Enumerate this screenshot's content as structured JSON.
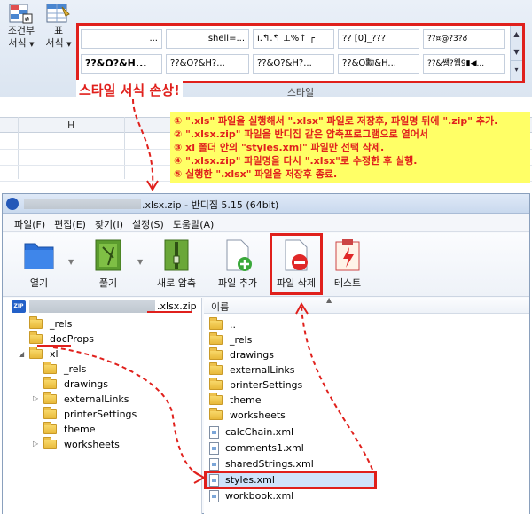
{
  "ribbon": {
    "conditional_format": {
      "line1": "조건부",
      "line2": "서식"
    },
    "table": {
      "line1": "표",
      "line2": "서식"
    },
    "gallery_row1": [
      "...",
      "shell=...",
      "ı.↰.↰ ⊥%↑ ┌",
      "?? [0]_???",
      "??¤@?3?☌"
    ],
    "gallery_row2": [
      "??&O?&H...",
      "??&O?&H?...",
      "??&O?&H?...",
      "??&O勳&H...",
      "??&쌩?웹9▮◀..."
    ],
    "group_label": "스타일",
    "damage_label": "스타일 서식 손상!"
  },
  "sheet": {
    "col_h": "H"
  },
  "steps": [
    {
      "num": "①",
      "text": " \".xls\" 파일을 실행해서 \".xlsx\" 파일로 저장후, 파일명 뒤에 \".zip\" 추가."
    },
    {
      "num": "②",
      "text": " \".xlsx.zip\" 파일을 반디집 같은 압축프로그램으로 열어서"
    },
    {
      "num": "③",
      "text": " xl 폴더 안의 \"styles.xml\" 파일만 선택 삭제."
    },
    {
      "num": "④",
      "text": " \".xlsx.zip\" 파일명을 다시 \".xlsx\"로 수정한 후 실행."
    },
    {
      "num": "⑤",
      "text": " 실행한 \".xlsx\" 파일을 저장후 종료."
    }
  ],
  "bandizip": {
    "title": ".xlsx.zip - 반디집 5.15 (64bit)",
    "menu": [
      "파일(F)",
      "편집(E)",
      "찾기(I)",
      "설정(S)",
      "도움말(A)"
    ],
    "toolbar": {
      "open": "열기",
      "extract": "풀기",
      "new_archive": "새로 압축",
      "add_file": "파일 추가",
      "delete_file": "파일 삭제",
      "test": "테스트"
    },
    "tree": {
      "zip_badge": "ZIP",
      "root_name": ".xlsx.zip",
      "items": [
        "_rels",
        "docProps",
        "xl",
        "_rels",
        "drawings",
        "externalLinks",
        "printerSettings",
        "theme",
        "worksheets"
      ]
    },
    "list": {
      "header": "이름",
      "files": [
        "..",
        "_rels",
        "drawings",
        "externalLinks",
        "printerSettings",
        "theme",
        "worksheets",
        "calcChain.xml",
        "comments1.xml",
        "sharedStrings.xml",
        "styles.xml",
        "workbook.xml"
      ]
    }
  },
  "colors": {
    "accent_red": "#e0201c",
    "note_yellow": "#ffff66"
  }
}
